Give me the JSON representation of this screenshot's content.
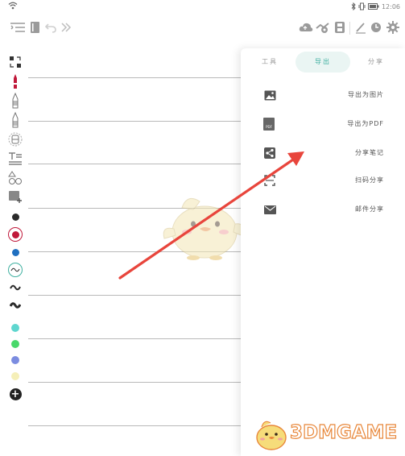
{
  "status_bar": {
    "time": "12:06"
  },
  "toolbar": {
    "left_icons": [
      "toc-icon",
      "notebook-icon",
      "undo-icon",
      "expand-icon"
    ],
    "right_icons": [
      "cloud-sync-icon",
      "settings-share-icon",
      "save-icon",
      "pen-icon",
      "history-icon",
      "gear-icon"
    ]
  },
  "tools": {
    "icons": [
      "lasso-icon",
      "marker-pen-icon",
      "pencil-icon",
      "fountain-pen-icon",
      "eraser-icon",
      "text-icon",
      "shapes-icon",
      "image-insert-icon"
    ],
    "colors": [
      "#2b2b2b",
      "#c0183a",
      "#1f6fc0",
      "#3fb0a0",
      "#2b2b2b",
      "#2b2b2b",
      "#5fd6cf",
      "#49d86b",
      "#7b8ce0",
      "#f5efb8"
    ],
    "add_label": "+"
  },
  "panel": {
    "tabs": [
      {
        "label": "工具"
      },
      {
        "label": "导出"
      },
      {
        "label": "分享"
      }
    ],
    "items": [
      {
        "icon": "image-icon",
        "label": "导出为图片"
      },
      {
        "icon": "pdf-icon",
        "label": "导出为PDF",
        "icon_text": "PDF"
      },
      {
        "icon": "share-icon",
        "label": "分享笔记"
      },
      {
        "icon": "qr-scan-icon",
        "label": "扫码分享"
      },
      {
        "icon": "mail-icon",
        "label": "邮件分享"
      }
    ]
  },
  "watermark": {
    "text": "3DMGAME"
  },
  "colors": {
    "accent": "#3fb0a0",
    "arrow": "#e8453c",
    "watermark": "#e8873a"
  }
}
